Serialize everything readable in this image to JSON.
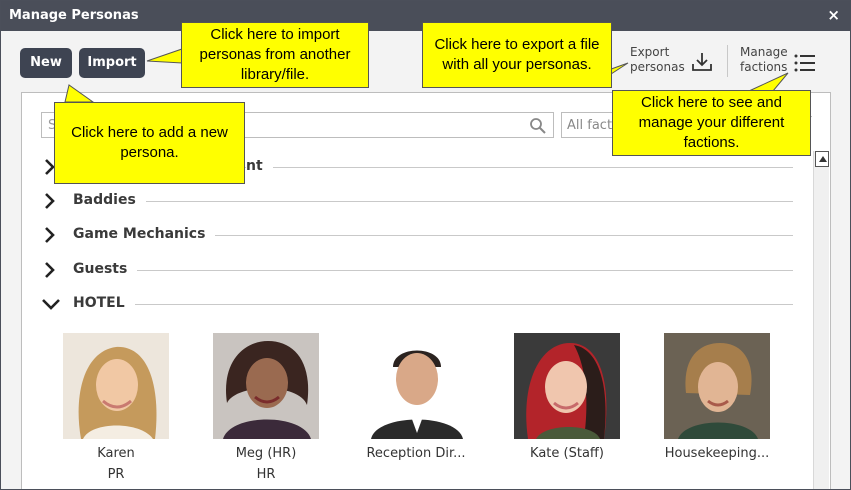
{
  "window": {
    "title": "Manage Personas",
    "close_label": "×"
  },
  "toolbar": {
    "new_label": "New",
    "import_label": "Import",
    "export_label": "Export\npersonas",
    "factions_label": "Manage\nfactions"
  },
  "search": {
    "placeholder": "S",
    "faction_filter": "All fact"
  },
  "groups": [
    {
      "name": "nt",
      "expanded": false
    },
    {
      "name": "Baddies",
      "expanded": false
    },
    {
      "name": "Game Mechanics",
      "expanded": false
    },
    {
      "name": "Guests",
      "expanded": false
    },
    {
      "name": "HOTEL",
      "expanded": true
    }
  ],
  "personas": [
    {
      "name": "Karen",
      "role": "PR"
    },
    {
      "name": "Meg (HR)",
      "role": "HR"
    },
    {
      "name": "Reception Dir...",
      "role": ""
    },
    {
      "name": "Kate (Staff)",
      "role": ""
    },
    {
      "name": "Housekeeping...",
      "role": ""
    }
  ],
  "callouts": {
    "import": "Click here to import personas from another library/file.",
    "export": "Click here to export a file with all your personas.",
    "new": "Click here to add a new persona.",
    "factions": "Click here to see and manage your different factions."
  },
  "colors": {
    "titlebar": "#4a4e59",
    "button": "#3e4452",
    "callout": "#ffff00"
  }
}
